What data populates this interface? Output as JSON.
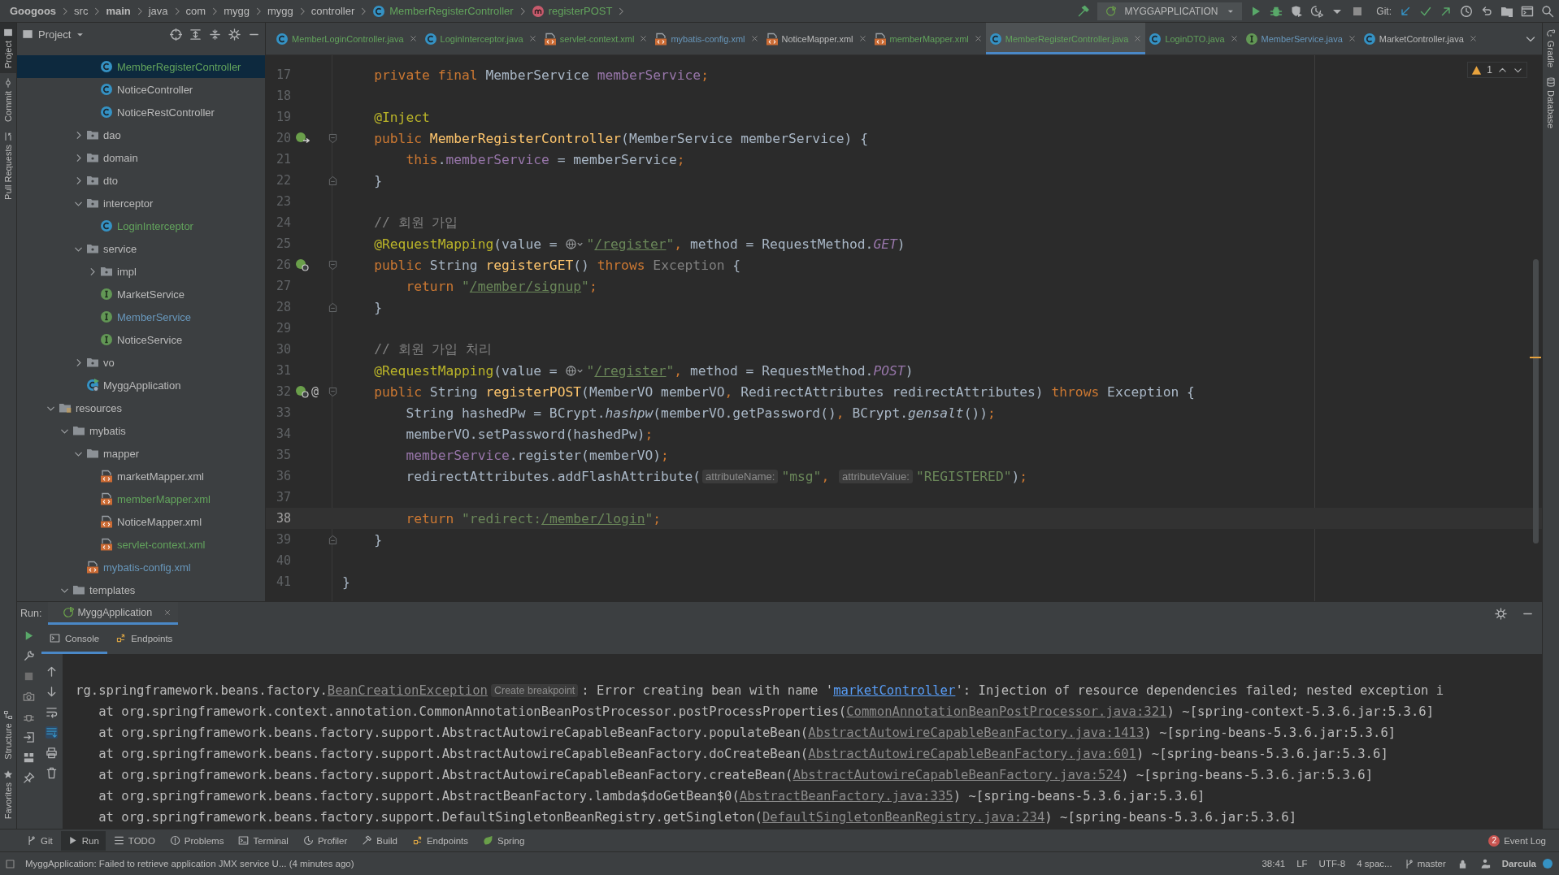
{
  "breadcrumbs": [
    {
      "label": "Googoos",
      "kind": "bold"
    },
    {
      "label": "src",
      "kind": "plain"
    },
    {
      "label": "main",
      "kind": "bold"
    },
    {
      "label": "java",
      "kind": "plain"
    },
    {
      "label": "com",
      "kind": "plain"
    },
    {
      "label": "mygg",
      "kind": "plain"
    },
    {
      "label": "mygg",
      "kind": "plain"
    },
    {
      "label": "controller",
      "kind": "plain"
    },
    {
      "label": "MemberRegisterController",
      "kind": "class"
    },
    {
      "label": "registerPOST",
      "kind": "method"
    }
  ],
  "toolbar": {
    "run_configuration": "MYGGAPPLICATION",
    "git_label": "Git:"
  },
  "left_strip": {
    "top": [
      {
        "label": "Project",
        "selected": true
      },
      {
        "label": "Commit",
        "selected": false
      },
      {
        "label": "Pull Requests",
        "selected": false
      }
    ],
    "bottom": [
      {
        "label": "Structure",
        "selected": false
      },
      {
        "label": "Favorites",
        "selected": false
      }
    ]
  },
  "right_strip": [
    {
      "label": "Gradle"
    },
    {
      "label": "Database"
    }
  ],
  "project_panel": {
    "title": "Project",
    "tree": [
      {
        "kind": "continuation",
        "children": [
          {
            "kind": "continuation",
            "children": [
              {
                "kind": "continuation",
                "children": [
                  {
                    "label": "MemberRegisterController",
                    "kind": "class",
                    "color": "#62a35c",
                    "selected": true
                  },
                  {
                    "label": "NoticeController",
                    "kind": "class",
                    "color": "#bbbbbb",
                    "selected": false
                  },
                  {
                    "label": "NoticeRestController",
                    "kind": "class",
                    "color": "#bbbbbb",
                    "selected": false
                  }
                ]
              },
              {
                "label": "dao",
                "kind": "package",
                "color": "#bbbbbb",
                "expanded": false,
                "selected": false
              },
              {
                "label": "domain",
                "kind": "package",
                "color": "#bbbbbb",
                "expanded": false,
                "selected": false
              },
              {
                "label": "dto",
                "kind": "package",
                "color": "#bbbbbb",
                "expanded": false,
                "selected": false
              },
              {
                "label": "interceptor",
                "kind": "package",
                "color": "#bbbbbb",
                "expanded": true,
                "selected": false,
                "children": [
                  {
                    "label": "LoginInterceptor",
                    "kind": "class",
                    "color": "#62a35c",
                    "selected": false
                  }
                ]
              },
              {
                "label": "service",
                "kind": "package",
                "color": "#bbbbbb",
                "expanded": true,
                "selected": false,
                "children": [
                  {
                    "label": "impl",
                    "kind": "package",
                    "color": "#bbbbbb",
                    "expanded": false,
                    "selected": false
                  },
                  {
                    "label": "MarketService",
                    "kind": "interface",
                    "color": "#bbbbbb",
                    "selected": false
                  },
                  {
                    "label": "MemberService",
                    "kind": "interface",
                    "color": "#6897bb",
                    "selected": false
                  },
                  {
                    "label": "NoticeService",
                    "kind": "interface",
                    "color": "#bbbbbb",
                    "selected": false
                  }
                ]
              },
              {
                "label": "vo",
                "kind": "package",
                "color": "#bbbbbb",
                "expanded": false,
                "selected": false
              },
              {
                "label": "MyggApplication",
                "kind": "app",
                "color": "#bbbbbb",
                "selected": false
              }
            ]
          }
        ]
      },
      {
        "label": "resources",
        "kind": "resources",
        "color": "#bbbbbb",
        "expanded": true,
        "selected": false,
        "children": [
          {
            "label": "mybatis",
            "kind": "folder",
            "color": "#bbbbbb",
            "expanded": true,
            "selected": false,
            "children": [
              {
                "label": "mapper",
                "kind": "folder",
                "color": "#bbbbbb",
                "expanded": true,
                "selected": false,
                "children": [
                  {
                    "label": "marketMapper.xml",
                    "kind": "xml",
                    "color": "#bbbbbb",
                    "selected": false
                  },
                  {
                    "label": "memberMapper.xml",
                    "kind": "xml",
                    "color": "#62a35c",
                    "selected": false
                  },
                  {
                    "label": "NoticeMapper.xml",
                    "kind": "xml",
                    "color": "#bbbbbb",
                    "selected": false
                  },
                  {
                    "label": "servlet-context.xml",
                    "kind": "xml",
                    "color": "#62a35c",
                    "selected": false
                  }
                ]
              },
              {
                "label": "mybatis-config.xml",
                "kind": "xml",
                "color": "#6897bb",
                "selected": false
              }
            ]
          },
          {
            "label": "templates",
            "kind": "folder",
            "color": "#bbbbbb",
            "expanded": true,
            "selected": false
          }
        ]
      }
    ]
  },
  "editor_tabs": [
    {
      "label": "MemberLoginController.java",
      "kind": "class",
      "color": "#62a35c",
      "selected": false
    },
    {
      "label": "LoginInterceptor.java",
      "kind": "class",
      "color": "#62a35c",
      "selected": false
    },
    {
      "label": "servlet-context.xml",
      "kind": "xml",
      "color": "#62a35c",
      "selected": false
    },
    {
      "label": "mybatis-config.xml",
      "kind": "xml",
      "color": "#6897bb",
      "selected": false
    },
    {
      "label": "NoticeMapper.xml",
      "kind": "xml",
      "color": "#bbbbbb",
      "selected": false
    },
    {
      "label": "memberMapper.xml",
      "kind": "xml",
      "color": "#62a35c",
      "selected": false
    },
    {
      "label": "MemberRegisterController.java",
      "kind": "class",
      "color": "#62a35c",
      "selected": true
    },
    {
      "label": "LoginDTO.java",
      "kind": "class",
      "color": "#62a35c",
      "selected": false
    },
    {
      "label": "MemberService.java",
      "kind": "interface",
      "color": "#6897bb",
      "selected": false
    },
    {
      "label": "MarketController.java",
      "kind": "class",
      "color": "#bbbbbb",
      "selected": false
    }
  ],
  "editor": {
    "warning_count": "1",
    "lines": [
      {
        "number": "17",
        "current": false,
        "tokens": [
          {
            "text": "    private final",
            "kind": "keyword"
          },
          {
            "text": " MemberService ",
            "kind": "plain"
          },
          {
            "text": "memberService",
            "kind": "field"
          },
          {
            "text": ";",
            "kind": "keyword"
          }
        ]
      },
      {
        "number": "18",
        "current": false
      },
      {
        "number": "19",
        "current": false,
        "tokens": [
          {
            "text": "    @Inject",
            "kind": "annotation"
          }
        ]
      },
      {
        "number": "20",
        "current": false,
        "gutter_icon": {
          "kind": "bean-navigate"
        },
        "fold": {
          "kind": "open"
        },
        "tokens": [
          {
            "text": "    public ",
            "kind": "keyword"
          },
          {
            "text": "MemberRegisterController",
            "kind": "declaration"
          },
          {
            "text": "(MemberService memberService) {",
            "kind": "plain"
          }
        ]
      },
      {
        "number": "21",
        "current": false,
        "tokens": [
          {
            "text": "        this",
            "kind": "keyword"
          },
          {
            "text": ".",
            "kind": "plain"
          },
          {
            "text": "memberService",
            "kind": "field"
          },
          {
            "text": " = memberService",
            "kind": "plain"
          },
          {
            "text": ";",
            "kind": "keyword"
          }
        ]
      },
      {
        "number": "22",
        "current": false,
        "fold": {
          "kind": "close"
        },
        "tokens": [
          {
            "text": "    }",
            "kind": "plain"
          }
        ]
      },
      {
        "number": "23",
        "current": false
      },
      {
        "number": "24",
        "current": false,
        "tokens": [
          {
            "text": "    // 회원 가입",
            "kind": "comment"
          }
        ]
      },
      {
        "number": "25",
        "current": false,
        "tokens": [
          {
            "text": "    @RequestMapping",
            "kind": "annotation"
          },
          {
            "text": "(value = ",
            "kind": "plain"
          },
          {
            "kind": "globe"
          },
          {
            "text": "\"",
            "kind": "string"
          },
          {
            "text": "/register",
            "kind": "url"
          },
          {
            "text": "\"",
            "kind": "string"
          },
          {
            "text": ", ",
            "kind": "keyword"
          },
          {
            "text": "method = RequestMethod.",
            "kind": "plain"
          },
          {
            "text": "GET",
            "kind": "constant"
          },
          {
            "text": ")",
            "kind": "plain"
          }
        ]
      },
      {
        "number": "26",
        "current": false,
        "gutter_icon": {
          "kind": "bean-web"
        },
        "fold": {
          "kind": "open"
        },
        "tokens": [
          {
            "text": "    public ",
            "kind": "keyword"
          },
          {
            "text": "String ",
            "kind": "plain"
          },
          {
            "text": "registerGET",
            "kind": "declaration"
          },
          {
            "text": "() ",
            "kind": "plain"
          },
          {
            "text": "throws ",
            "kind": "keyword"
          },
          {
            "text": "Exception",
            "kind": "dim"
          },
          {
            "text": " {",
            "kind": "plain"
          }
        ]
      },
      {
        "number": "27",
        "current": false,
        "tokens": [
          {
            "text": "        return ",
            "kind": "keyword"
          },
          {
            "text": "\"",
            "kind": "string"
          },
          {
            "text": "/member/signup",
            "kind": "url"
          },
          {
            "text": "\"",
            "kind": "string"
          },
          {
            "text": ";",
            "kind": "keyword"
          }
        ]
      },
      {
        "number": "28",
        "current": false,
        "fold": {
          "kind": "close"
        },
        "tokens": [
          {
            "text": "    }",
            "kind": "plain"
          }
        ]
      },
      {
        "number": "29",
        "current": false
      },
      {
        "number": "30",
        "current": false,
        "tokens": [
          {
            "text": "    // 회원 가입 처리",
            "kind": "comment"
          }
        ]
      },
      {
        "number": "31",
        "current": false,
        "tokens": [
          {
            "text": "    @RequestMapping",
            "kind": "annotation"
          },
          {
            "text": "(value = ",
            "kind": "plain"
          },
          {
            "kind": "globe"
          },
          {
            "text": "\"",
            "kind": "string"
          },
          {
            "text": "/register",
            "kind": "url"
          },
          {
            "text": "\"",
            "kind": "string"
          },
          {
            "text": ", ",
            "kind": "keyword"
          },
          {
            "text": "method = RequestMethod.",
            "kind": "plain"
          },
          {
            "text": "POST",
            "kind": "constant"
          },
          {
            "text": ")",
            "kind": "plain"
          }
        ]
      },
      {
        "number": "32",
        "current": false,
        "gutter_icon": {
          "kind": "bean-web"
        },
        "gutter_mark": "@",
        "fold": {
          "kind": "open"
        },
        "tokens": [
          {
            "text": "    public ",
            "kind": "keyword"
          },
          {
            "text": "String ",
            "kind": "plain"
          },
          {
            "text": "registerPOST",
            "kind": "declaration"
          },
          {
            "text": "(MemberVO memberVO",
            "kind": "plain"
          },
          {
            "text": ", ",
            "kind": "keyword"
          },
          {
            "text": "RedirectAttributes redirectAttributes) ",
            "kind": "plain"
          },
          {
            "text": "throws ",
            "kind": "keyword"
          },
          {
            "text": "Exception {",
            "kind": "plain"
          }
        ]
      },
      {
        "number": "33",
        "current": false,
        "tokens": [
          {
            "text": "        String hashedPw = BCrypt.",
            "kind": "plain"
          },
          {
            "text": "hashpw",
            "kind": "static"
          },
          {
            "text": "(memberVO.getPassword()",
            "kind": "plain"
          },
          {
            "text": ", ",
            "kind": "keyword"
          },
          {
            "text": "BCrypt.",
            "kind": "plain"
          },
          {
            "text": "gensalt",
            "kind": "static"
          },
          {
            "text": "())",
            "kind": "plain"
          },
          {
            "text": ";",
            "kind": "keyword"
          }
        ]
      },
      {
        "number": "34",
        "current": false,
        "tokens": [
          {
            "text": "        memberVO.setPassword(hashedPw)",
            "kind": "plain"
          },
          {
            "text": ";",
            "kind": "keyword"
          }
        ]
      },
      {
        "number": "35",
        "current": false,
        "tokens": [
          {
            "text": "        memberService",
            "kind": "field"
          },
          {
            "text": ".register(memberVO)",
            "kind": "plain"
          },
          {
            "text": ";",
            "kind": "keyword"
          }
        ]
      },
      {
        "number": "36",
        "current": false,
        "tokens": [
          {
            "text": "        redirectAttributes.addFlashAttribute(",
            "kind": "plain"
          },
          {
            "text": "attributeName:",
            "kind": "hint"
          },
          {
            "text": "\"msg\"",
            "kind": "string"
          },
          {
            "text": ", ",
            "kind": "keyword"
          },
          {
            "text": "attributeValue:",
            "kind": "hint"
          },
          {
            "text": "\"REGISTERED\"",
            "kind": "string"
          },
          {
            "text": ")",
            "kind": "plain"
          },
          {
            "text": ";",
            "kind": "keyword"
          }
        ]
      },
      {
        "number": "37",
        "current": false
      },
      {
        "number": "38",
        "current": true,
        "tokens": [
          {
            "text": "        return ",
            "kind": "keyword"
          },
          {
            "text": "\"redirect:",
            "kind": "string"
          },
          {
            "text": "/member/login",
            "kind": "url"
          },
          {
            "text": "\"",
            "kind": "string"
          },
          {
            "text": ";",
            "kind": "keyword"
          }
        ]
      },
      {
        "number": "39",
        "current": false,
        "fold": {
          "kind": "close"
        },
        "tokens": [
          {
            "text": "    }",
            "kind": "plain"
          }
        ]
      },
      {
        "number": "40",
        "current": false
      },
      {
        "number": "41",
        "current": false,
        "tokens": [
          {
            "text": "}",
            "kind": "plain"
          }
        ]
      }
    ]
  },
  "run_panel": {
    "label": "Run:",
    "tabs": [
      {
        "label": "MyggApplication",
        "selected": true
      }
    ],
    "subtabs": [
      {
        "label": "Console",
        "kind": "console",
        "selected": true
      },
      {
        "label": "Endpoints",
        "kind": "endpoints",
        "selected": false
      }
    ],
    "console": [
      {
        "kind": "exception",
        "tokens": [
          {
            "text": "rg.springframework.beans.factory.",
            "kind": "text"
          },
          {
            "text": "BeanCreationException",
            "kind": "ref"
          },
          {
            "text": "Create breakpoint",
            "kind": "hint"
          },
          {
            "text": ": Error creating bean with name '",
            "kind": "text"
          },
          {
            "text": "marketController",
            "kind": "link"
          },
          {
            "text": "': Injection of resource dependencies failed; nested exception i",
            "kind": "text"
          }
        ]
      },
      {
        "kind": "frame",
        "tokens": [
          {
            "text": "at org.springframework.context.annotation.CommonAnnotationBeanPostProcessor.postProcessProperties(",
            "kind": "text"
          },
          {
            "text": "CommonAnnotationBeanPostProcessor.java:321",
            "kind": "ref"
          },
          {
            "text": ") ~[spring-context-5.3.6.jar:5.3.6]",
            "kind": "text"
          }
        ]
      },
      {
        "kind": "frame",
        "tokens": [
          {
            "text": "at org.springframework.beans.factory.support.AbstractAutowireCapableBeanFactory.populateBean(",
            "kind": "text"
          },
          {
            "text": "AbstractAutowireCapableBeanFactory.java:1413",
            "kind": "ref"
          },
          {
            "text": ") ~[spring-beans-5.3.6.jar:5.3.6]",
            "kind": "text"
          }
        ]
      },
      {
        "kind": "frame",
        "tokens": [
          {
            "text": "at org.springframework.beans.factory.support.AbstractAutowireCapableBeanFactory.doCreateBean(",
            "kind": "text"
          },
          {
            "text": "AbstractAutowireCapableBeanFactory.java:601",
            "kind": "ref"
          },
          {
            "text": ") ~[spring-beans-5.3.6.jar:5.3.6]",
            "kind": "text"
          }
        ]
      },
      {
        "kind": "frame",
        "tokens": [
          {
            "text": "at org.springframework.beans.factory.support.AbstractAutowireCapableBeanFactory.createBean(",
            "kind": "text"
          },
          {
            "text": "AbstractAutowireCapableBeanFactory.java:524",
            "kind": "ref"
          },
          {
            "text": ") ~[spring-beans-5.3.6.jar:5.3.6]",
            "kind": "text"
          }
        ]
      },
      {
        "kind": "frame",
        "tokens": [
          {
            "text": "at org.springframework.beans.factory.support.AbstractBeanFactory.lambda$doGetBean$0(",
            "kind": "text"
          },
          {
            "text": "AbstractBeanFactory.java:335",
            "kind": "ref"
          },
          {
            "text": ") ~[spring-beans-5.3.6.jar:5.3.6]",
            "kind": "text"
          }
        ]
      },
      {
        "kind": "frame",
        "tokens": [
          {
            "text": "at org.springframework.beans.factory.support.DefaultSingletonBeanRegistry.getSingleton(",
            "kind": "text"
          },
          {
            "text": "DefaultSingletonBeanRegistry.java:234",
            "kind": "ref"
          },
          {
            "text": ") ~[spring-beans-5.3.6.jar:5.3.6]",
            "kind": "text"
          }
        ]
      }
    ]
  },
  "tool_windows": [
    {
      "label": "Git",
      "kind": "git",
      "selected": false
    },
    {
      "label": "Run",
      "kind": "run",
      "selected": true
    },
    {
      "label": "TODO",
      "kind": "todo",
      "selected": false
    },
    {
      "label": "Problems",
      "kind": "problems",
      "selected": false
    },
    {
      "label": "Terminal",
      "kind": "terminal",
      "selected": false
    },
    {
      "label": "Profiler",
      "kind": "profiler",
      "selected": false
    },
    {
      "label": "Build",
      "kind": "build",
      "selected": false
    },
    {
      "label": "Endpoints",
      "kind": "endpoints",
      "selected": false
    },
    {
      "label": "Spring",
      "kind": "spring",
      "selected": false
    }
  ],
  "event_log": {
    "label": "Event Log",
    "count": "2"
  },
  "status_bar": {
    "message": "MyggApplication: Failed to retrieve application JMX service U... (4 minutes ago)",
    "items": [
      {
        "text": "38:41",
        "kind": "text"
      },
      {
        "text": "LF",
        "kind": "text"
      },
      {
        "text": "UTF-8",
        "kind": "text"
      },
      {
        "text": "4 spac...",
        "kind": "text"
      },
      {
        "text": "master",
        "kind": "branch"
      },
      {
        "text": "Darcula",
        "kind": "theme"
      }
    ]
  }
}
